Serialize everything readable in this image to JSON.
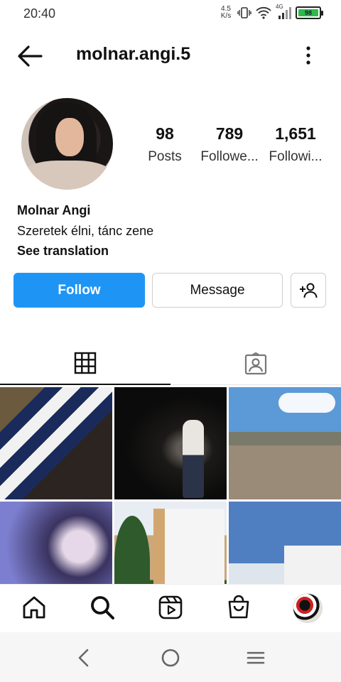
{
  "status": {
    "time": "20:40",
    "speed_value": "4.5",
    "speed_unit": "K/s",
    "network": "4G",
    "battery": "98"
  },
  "header": {
    "username": "molnar.angi.5"
  },
  "stats": [
    {
      "value": "98",
      "label": "Posts"
    },
    {
      "value": "789",
      "label": "Followe..."
    },
    {
      "value": "1,651",
      "label": "Followi..."
    }
  ],
  "bio": {
    "name": "Molnar Angi",
    "text": "Szeretek élni, tánc zene",
    "translate": "See translation"
  },
  "buttons": {
    "follow": "Follow",
    "message": "Message"
  },
  "colors": {
    "accent": "#1e95f5",
    "battery": "#2fb94a"
  },
  "icons": {
    "back": "arrow-left-icon",
    "more": "more-vertical-icon",
    "add_user": "add-user-icon",
    "grid_tab": "grid-icon",
    "tagged_tab": "tagged-icon",
    "nav": [
      "home-icon",
      "search-icon",
      "reels-icon",
      "shop-icon",
      "profile-avatar"
    ],
    "system": [
      "back-triangle-icon",
      "home-circle-icon",
      "menu-lines-icon"
    ]
  }
}
